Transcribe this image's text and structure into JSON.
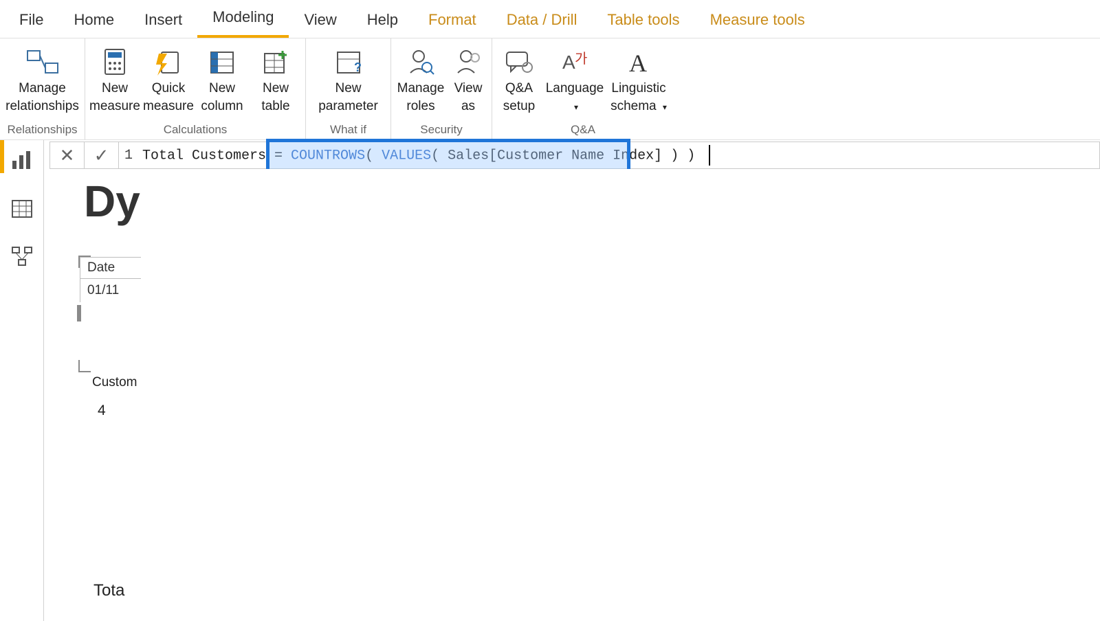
{
  "tabs": {
    "file": "File",
    "home": "Home",
    "insert": "Insert",
    "modeling": "Modeling",
    "view": "View",
    "help": "Help",
    "format": "Format",
    "datadrill": "Data / Drill",
    "tabletools": "Table tools",
    "measuretools": "Measure tools"
  },
  "groups": {
    "relationships": "Relationships",
    "calculations": "Calculations",
    "whatif": "What if",
    "security": "Security",
    "qa": "Q&A"
  },
  "buttons": {
    "manage_rel": "Manage\nrelationships",
    "new_measure": "New\nmeasure",
    "quick_measure": "Quick\nmeasure",
    "new_column": "New\ncolumn",
    "new_table": "New\ntable",
    "new_parameter": "New\nparameter",
    "manage_roles": "Manage\nroles",
    "view_as": "View\nas",
    "qa_setup": "Q&A\nsetup",
    "language": "Language",
    "linguistic": "Linguistic\nschema"
  },
  "formula": {
    "line_no": "1",
    "measure_name": "Total Customers",
    "equals": " = ",
    "fn1": "COUNTROWS",
    "fn2": "VALUES",
    "colref": "Sales[Customer Name Index]",
    "highlighted_text": "COUNTROWS( VALUES( Sales[Customer Name Index] ) )"
  },
  "canvas": {
    "title_peek": "Dy",
    "date_label": "Date",
    "date_value": "01/11",
    "custom_label": "Custom",
    "custom_value": "4",
    "total_peek": "Tota"
  }
}
